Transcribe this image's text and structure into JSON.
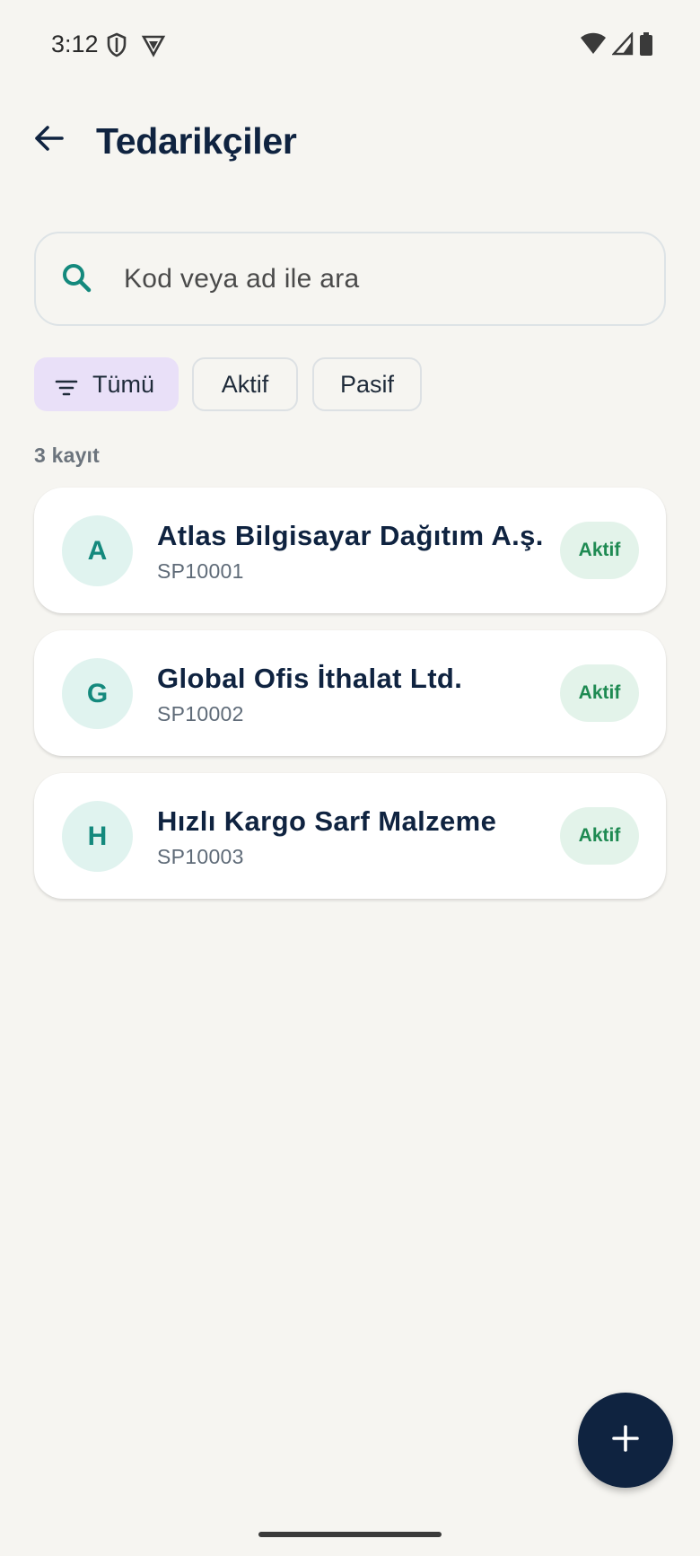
{
  "status_bar": {
    "time": "3:12"
  },
  "app_bar": {
    "title": "Tedarikçiler"
  },
  "search": {
    "placeholder": "Kod veya ad ile ara",
    "value": ""
  },
  "filters": {
    "chips": [
      {
        "label": "Tümü",
        "selected": true
      },
      {
        "label": "Aktif",
        "selected": false
      },
      {
        "label": "Pasif",
        "selected": false
      }
    ]
  },
  "list": {
    "record_count": "3 kayıt",
    "items": [
      {
        "initial": "A",
        "name": "Atlas Bilgisayar Dağıtım A.ş.",
        "code": "SP10001",
        "status": "Aktif"
      },
      {
        "initial": "G",
        "name": "Global Ofis İthalat Ltd.",
        "code": "SP10002",
        "status": "Aktif"
      },
      {
        "initial": "H",
        "name": "Hızlı Kargo Sarf Malzeme",
        "code": "SP10003",
        "status": "Aktif"
      }
    ]
  },
  "colors": {
    "primary": "#0f2340",
    "accent_teal": "#14897d",
    "selected_chip": "#e9e0f8",
    "status_active": "#1e8a52"
  },
  "icons": {
    "back": "arrow-left-icon",
    "search": "search-icon",
    "filter": "filter-icon",
    "fab": "plus-icon"
  }
}
